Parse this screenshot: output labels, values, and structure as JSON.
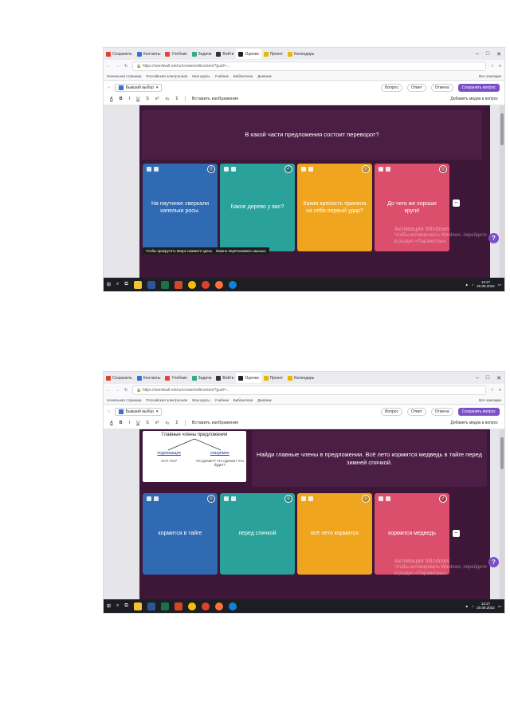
{
  "browser": {
    "tabs": [
      "Сохранить",
      "Контакты",
      "Учебник",
      "Задачи",
      "Войти",
      "Оценки",
      "Проект",
      "Календарь",
      "Новая вкладка"
    ],
    "window_controls": [
      "–",
      "□",
      "✕"
    ],
    "url": "https://wordwall.net/ru/create/editcontent?guid=...",
    "bookmarks": [
      "Начальная страница",
      "Российская электронная",
      "Мои курсы",
      "Учебник",
      "Библиотека",
      "Дневник",
      "Все закладки"
    ]
  },
  "editor": {
    "template_select": "Бывший выбор",
    "btn_question": "Вопрос",
    "btn_answer": "Ответ",
    "btn_recent": "Отмена",
    "save_button": "Сохранить вопрос",
    "format_buttons": [
      "A",
      "B",
      "I",
      "U",
      "S",
      "x²",
      "x₂",
      "Σ"
    ],
    "format_hint": "Вставить изображение",
    "add_media": "Добавить медиа в вопрос"
  },
  "slide1": {
    "question": "В какой части предложения состоит переворот?",
    "cards": [
      {
        "label": "На паутинке сверкали капельки росы.",
        "color": "blue",
        "mark": "◎"
      },
      {
        "label": "Какое дерево у вас?",
        "color": "teal",
        "mark": "✓"
      },
      {
        "label": "Какая крепость приняла на себя первый удар?",
        "color": "orange",
        "mark": "◎"
      },
      {
        "label": "До чего же хороши круги!",
        "color": "pink",
        "mark": "◎"
      }
    ],
    "hints": [
      "Чтобы прокрутить вверх нажмите здесь",
      "Можно перетаскивать мышью"
    ]
  },
  "slide2": {
    "diagram_title": "Главные члены предложения",
    "diagram_left_title": "подлежащее",
    "diagram_left_text": "кто? что?",
    "diagram_right_title": "сказуемое",
    "diagram_right_text": "что делает? что сделал? что будет?",
    "question": "Найди главные члены в предложении. Всё лето кормится медведь в тайге перед зимней спячкой.",
    "cards": [
      {
        "label": "кормится в тайге",
        "color": "blue",
        "mark": "◎"
      },
      {
        "label": "перед спячкой",
        "color": "teal",
        "mark": "◎"
      },
      {
        "label": "всё лето кормится",
        "color": "orange",
        "mark": "◎"
      },
      {
        "label": "кормится медведь",
        "color": "pink",
        "mark": "✓"
      }
    ]
  },
  "watermark": {
    "title": "Активация Windows",
    "text": "Чтобы активировать Windows, перейдите в раздел «Параметры»."
  },
  "help_label": "?",
  "minus_label": "−",
  "taskbar": {
    "start": "⊞",
    "time": "12:27",
    "date": "20.09.2022"
  },
  "colors": {
    "stage": "#3d1638",
    "blue": "#2f6ab2",
    "teal": "#2aa19a",
    "orange": "#f0a51f",
    "pink": "#dc4f6c",
    "accent": "#7b4fc8"
  }
}
